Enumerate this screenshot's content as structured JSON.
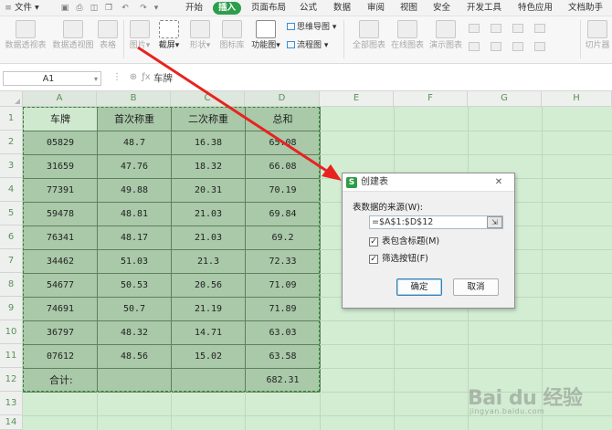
{
  "menu": {
    "file_label": "文件",
    "tabs": [
      "开始",
      "插入",
      "页面布局",
      "公式",
      "数据",
      "审阅",
      "视图",
      "安全",
      "开发工具",
      "特色应用",
      "文档助手"
    ],
    "active_tab_index": 1
  },
  "ribbon": {
    "pivot_table": "数据透视表",
    "pivot_view": "数据透视图",
    "table": "表格",
    "picture": "图片",
    "screenshot": "截屏",
    "shapes": "形状",
    "icon_lib": "图标库",
    "func_chart": "功能图",
    "mind_map": "思维导图",
    "flowchart": "流程图",
    "all_charts": "全部图表",
    "online_charts": "在线图表",
    "demo_charts": "演示图表",
    "slicer": "切片器"
  },
  "formula_bar": {
    "name_box": "A1",
    "content": "车牌"
  },
  "columns": [
    "A",
    "B",
    "C",
    "D",
    "E",
    "F",
    "G",
    "H"
  ],
  "rows": [
    "1",
    "2",
    "3",
    "4",
    "5",
    "6",
    "7",
    "8",
    "9",
    "10",
    "11",
    "12",
    "13",
    "14"
  ],
  "table": {
    "headers": [
      "车牌",
      "首次称重",
      "二次称重",
      "总和"
    ],
    "rows": [
      [
        "05829",
        "48.7",
        "16.38",
        "65.08"
      ],
      [
        "31659",
        "47.76",
        "18.32",
        "66.08"
      ],
      [
        "77391",
        "49.88",
        "20.31",
        "70.19"
      ],
      [
        "59478",
        "48.81",
        "21.03",
        "69.84"
      ],
      [
        "76341",
        "48.17",
        "21.03",
        "69.2"
      ],
      [
        "34462",
        "51.03",
        "21.3",
        "72.33"
      ],
      [
        "54677",
        "50.53",
        "20.56",
        "71.09"
      ],
      [
        "74691",
        "50.7",
        "21.19",
        "71.89"
      ],
      [
        "36797",
        "48.32",
        "14.71",
        "63.03"
      ],
      [
        "07612",
        "48.56",
        "15.02",
        "63.58"
      ]
    ],
    "total_label": "合计:",
    "total_value": "682.31"
  },
  "dialog": {
    "title": "创建表",
    "source_label": "表数据的来源(W):",
    "source_value": "=$A$1:$D$12",
    "has_headers_label": "表包含标题(M)",
    "has_headers_checked": true,
    "filter_label": "筛选按钮(F)",
    "filter_checked": true,
    "ok_label": "确定",
    "cancel_label": "取消"
  },
  "watermark": {
    "logo_text": "Bai du 经验",
    "url": "jingyan.baidu.com"
  },
  "colors": {
    "accent_green": "#2d9e4c",
    "selection_fill": "#d3edd3",
    "table_fill": "#a9c9a9",
    "arrow": "#e8231f"
  }
}
